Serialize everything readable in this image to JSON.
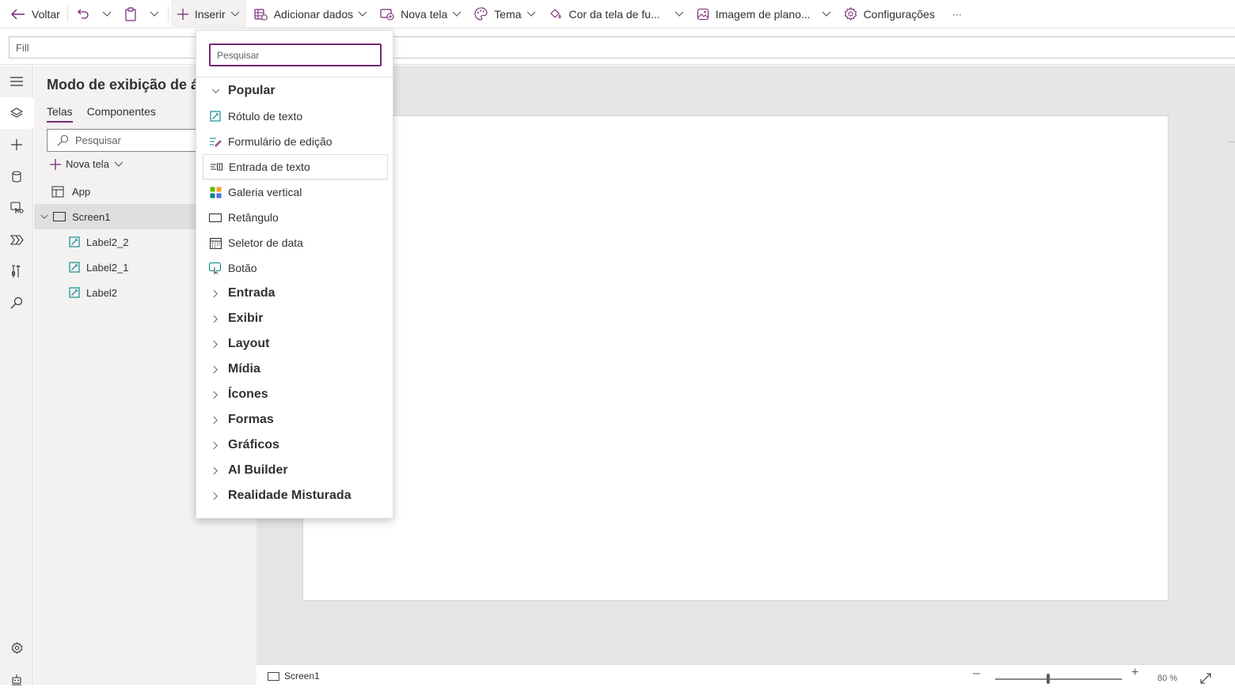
{
  "toolbar": {
    "back": "Voltar",
    "insert": "Inserir",
    "add_data": "Adicionar dados",
    "new_screen": "Nova tela",
    "theme": "Tema",
    "screen_color": "Cor da tela de fu...",
    "background_image": "Imagem de plano...",
    "settings": "Configurações",
    "more": "···"
  },
  "formula_bar": {
    "property": "Fill",
    "formula": ""
  },
  "tree_view": {
    "title": "Modo de exibição de á",
    "tabs": [
      "Telas",
      "Componentes"
    ],
    "search_placeholder": "Pesquisar",
    "new_screen": "Nova tela",
    "items": [
      {
        "label": "App"
      },
      {
        "label": "Screen1"
      },
      {
        "label": "Label2_2"
      },
      {
        "label": "Label2_1"
      },
      {
        "label": "Label2"
      }
    ]
  },
  "insert_menu": {
    "search_placeholder": "Pesquisar",
    "popular_title": "Popular",
    "popular_items": [
      {
        "label": "Rótulo de texto",
        "icon": "text-label-icon"
      },
      {
        "label": "Formulário de edição",
        "icon": "edit-form-icon"
      },
      {
        "label": "Entrada de texto",
        "icon": "text-input-icon"
      },
      {
        "label": "Galeria vertical",
        "icon": "gallery-icon"
      },
      {
        "label": "Retângulo",
        "icon": "rectangle-icon"
      },
      {
        "label": "Seletor de data",
        "icon": "calendar-icon"
      },
      {
        "label": "Botão",
        "icon": "button-icon"
      }
    ],
    "categories": [
      {
        "label": "Entrada"
      },
      {
        "label": "Exibir"
      },
      {
        "label": "Layout"
      },
      {
        "label": "Mídia"
      },
      {
        "label": "Ícones"
      },
      {
        "label": "Formas"
      },
      {
        "label": "Gráficos"
      },
      {
        "label": "AI Builder"
      },
      {
        "label": "Realidade Misturada"
      }
    ]
  },
  "status_bar": {
    "screen": "Screen1",
    "zoom": "80  %",
    "zoom_level": 0.42
  },
  "colors": {
    "accent": "#742774",
    "panel": "#f3f2f1",
    "canvas": "#e6e6e6"
  }
}
